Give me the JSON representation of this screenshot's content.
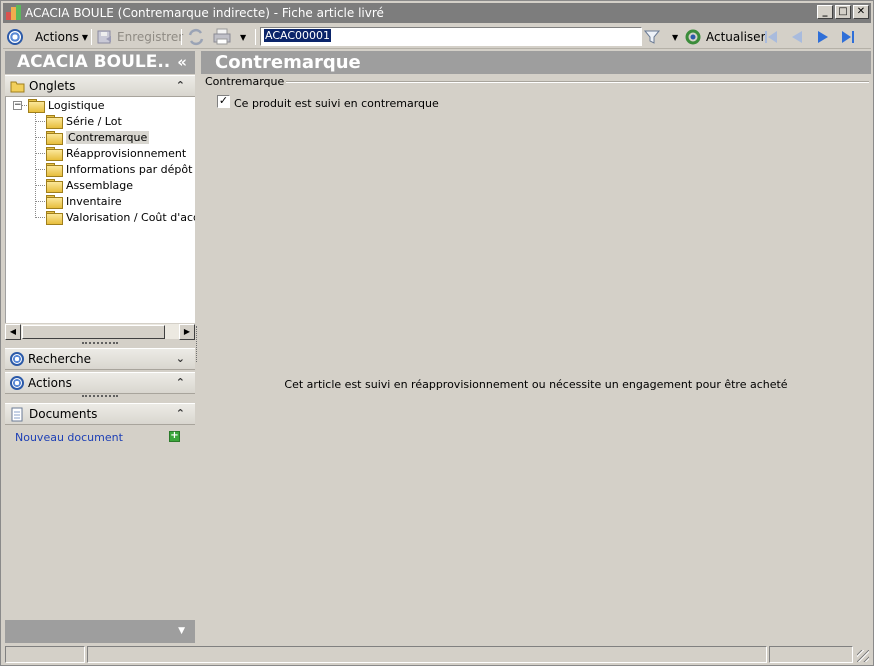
{
  "window": {
    "title": "ACACIA BOULE (Contremarque indirecte) - Fiche article livré",
    "buttons": [
      "minimize",
      "maximize",
      "close"
    ]
  },
  "toolbar": {
    "actions_label": "Actions",
    "save_label": "Enregistrer",
    "record_value": "ACAC00001",
    "refresh_label": "Actualiser"
  },
  "left_panel": {
    "header_title": "ACACIA BOULE..",
    "collapse_glyph": "«",
    "onglets": {
      "label": "Onglets",
      "root": "Logistique",
      "items": [
        {
          "label": "Série / Lot",
          "selected": false
        },
        {
          "label": "Contremarque",
          "selected": true
        },
        {
          "label": "Réapprovisionnement",
          "selected": false
        },
        {
          "label": "Informations par dépôt",
          "selected": false
        },
        {
          "label": "Assemblage",
          "selected": false
        },
        {
          "label": "Inventaire",
          "selected": false
        },
        {
          "label": "Valorisation / Coût d'acquis",
          "selected": false
        }
      ]
    },
    "recherche": {
      "label": "Recherche"
    },
    "actions": {
      "label": "Actions"
    },
    "documents": {
      "label": "Documents",
      "new_document": "Nouveau document"
    }
  },
  "main": {
    "header_title": "Contremarque",
    "group_label": "Contremarque",
    "checkbox_label": "Ce produit est suivi en contremarque",
    "checkbox_checked": true,
    "info_message": "Cet article est suivi en réapprovisionnement ou nécessite un engagement pour être acheté"
  },
  "colors": {
    "header_bg": "#9e9e9e",
    "window_bg": "#d4d0c8",
    "link": "#1d3fb5",
    "selection": "#0a246a"
  }
}
